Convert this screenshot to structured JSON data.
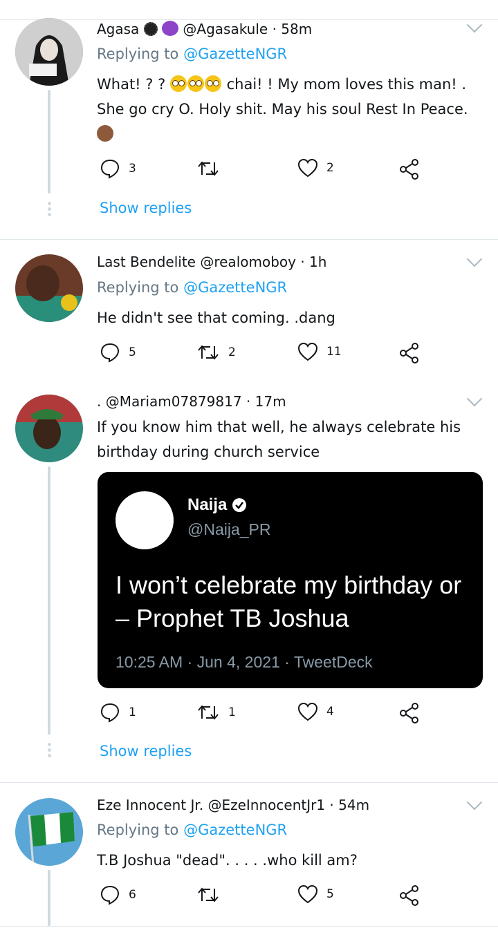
{
  "colors": {
    "link": "#1da1f2",
    "muted": "#657786",
    "divider": "#e1e8ed"
  },
  "tweets": [
    {
      "name": "Agasa",
      "name_emojis": [
        "flower",
        "smiling-imp"
      ],
      "handle": "@Agasakule",
      "sep": "·",
      "time": "58m",
      "replying_label": "Replying to",
      "replying_to": "@GazetteNGR",
      "text_parts": [
        "What! ? ? ",
        " chai! ! My mom loves this man! . She go cry O. Holy shit. May his soul Rest In Peace. "
      ],
      "actions": {
        "replies": "3",
        "retweets": "",
        "likes": "2"
      },
      "show_replies": "Show replies"
    },
    {
      "name": "Last Bendelite",
      "handle": "@realomoboy",
      "sep": "·",
      "time": "1h",
      "replying_label": "Replying to",
      "replying_to": "@GazetteNGR",
      "text": "He didn't see that coming. .dang",
      "actions": {
        "replies": "5",
        "retweets": "2",
        "likes": "11"
      }
    },
    {
      "name": ".",
      "handle": "@Mariam07879817",
      "sep": "·",
      "time": "17m",
      "text": "If you know him that well, he always celebrate his birthday during church service",
      "quote": {
        "name": "Naija",
        "verified": true,
        "handle": "@Naija_PR",
        "text_line1": "I won’t celebrate my birthday or",
        "text_line2": "– Prophet TB Joshua",
        "meta": "10:25 AM · Jun 4, 2021 · TweetDeck"
      },
      "actions": {
        "replies": "1",
        "retweets": "1",
        "likes": "4"
      },
      "show_replies": "Show replies"
    },
    {
      "name": "Eze Innocent Jr.",
      "handle": "@EzeInnocentJr1",
      "sep": "·",
      "time": "54m",
      "replying_label": "Replying to",
      "replying_to": "@GazetteNGR",
      "text": "T.B Joshua \"dead\". . . . .who kill am?",
      "actions": {
        "replies": "6",
        "retweets": "",
        "likes": "5"
      }
    }
  ]
}
